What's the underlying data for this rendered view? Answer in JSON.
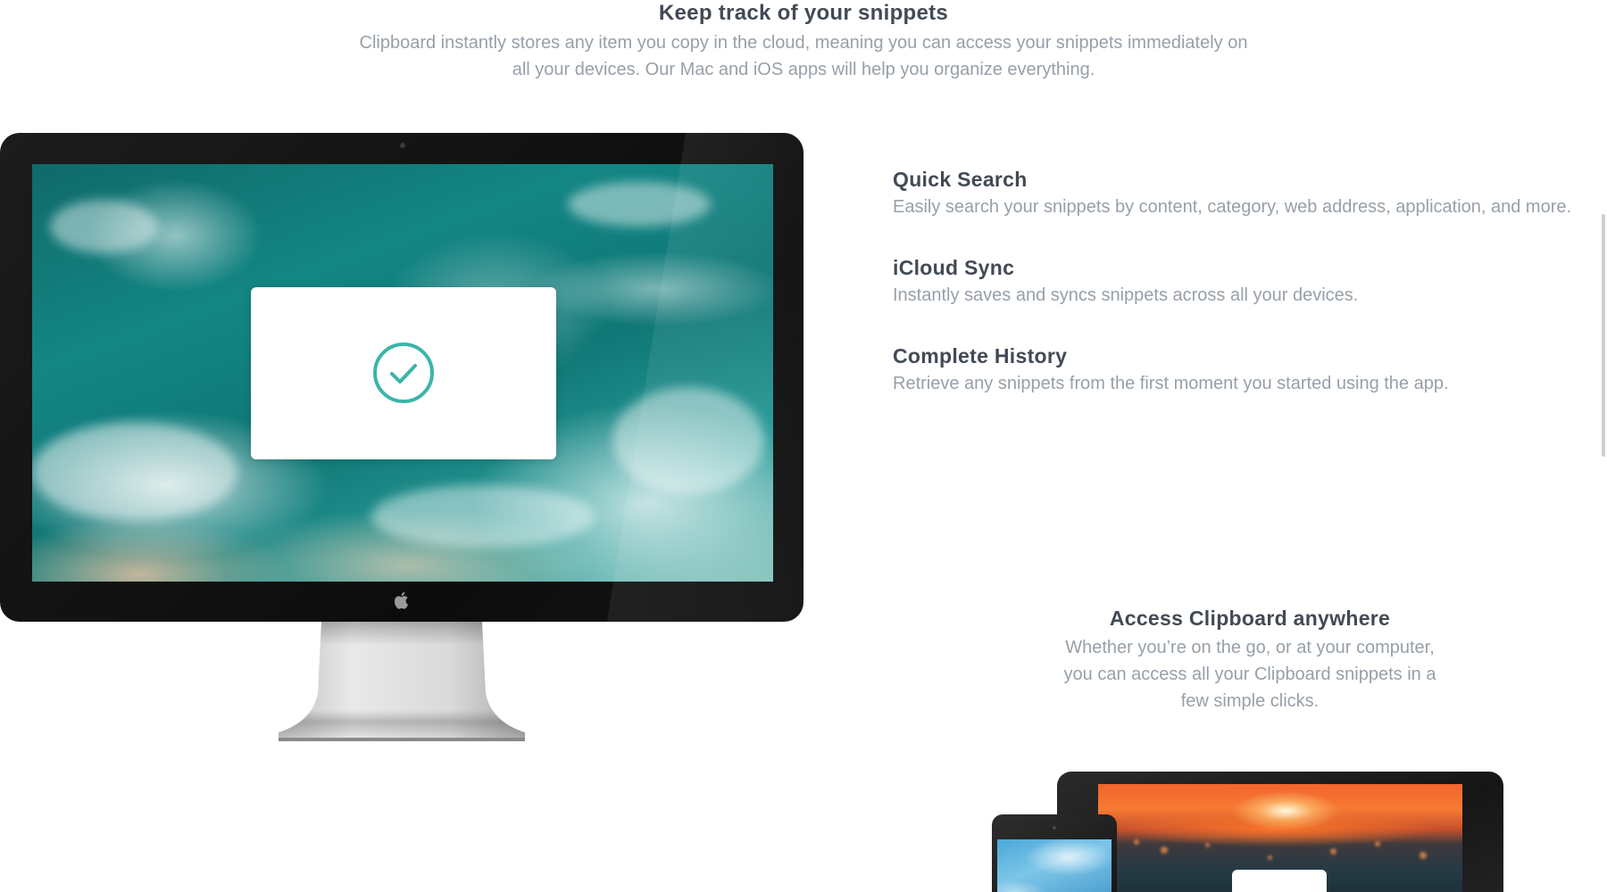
{
  "intro": {
    "title": "Keep track of your snippets",
    "text": "Clipboard instantly stores any item you copy in the cloud, meaning you can access your snippets immediately on all your devices. Our Mac and iOS apps will help you organize everything."
  },
  "features": [
    {
      "title": "Quick Search",
      "description": "Easily search your snippets by content, category, web address, application, and more."
    },
    {
      "title": "iCloud Sync",
      "description": "Instantly saves and syncs snippets across all your devices."
    },
    {
      "title": "Complete History",
      "description": "Retrieve any snippets from the first moment you started using the app."
    }
  ],
  "access": {
    "title": "Access Clipboard anywhere",
    "text": "Whether you’re on the go, or at your computer, you can access all your Clipboard snippets in a few simple clicks."
  },
  "icons": {
    "check": "check-circle-icon",
    "apple": "apple-logo-icon"
  },
  "colors": {
    "heading": "#424a54",
    "body_text": "#97a0a9",
    "accent_teal": "#3ab5a8",
    "background": "#ffffff"
  }
}
